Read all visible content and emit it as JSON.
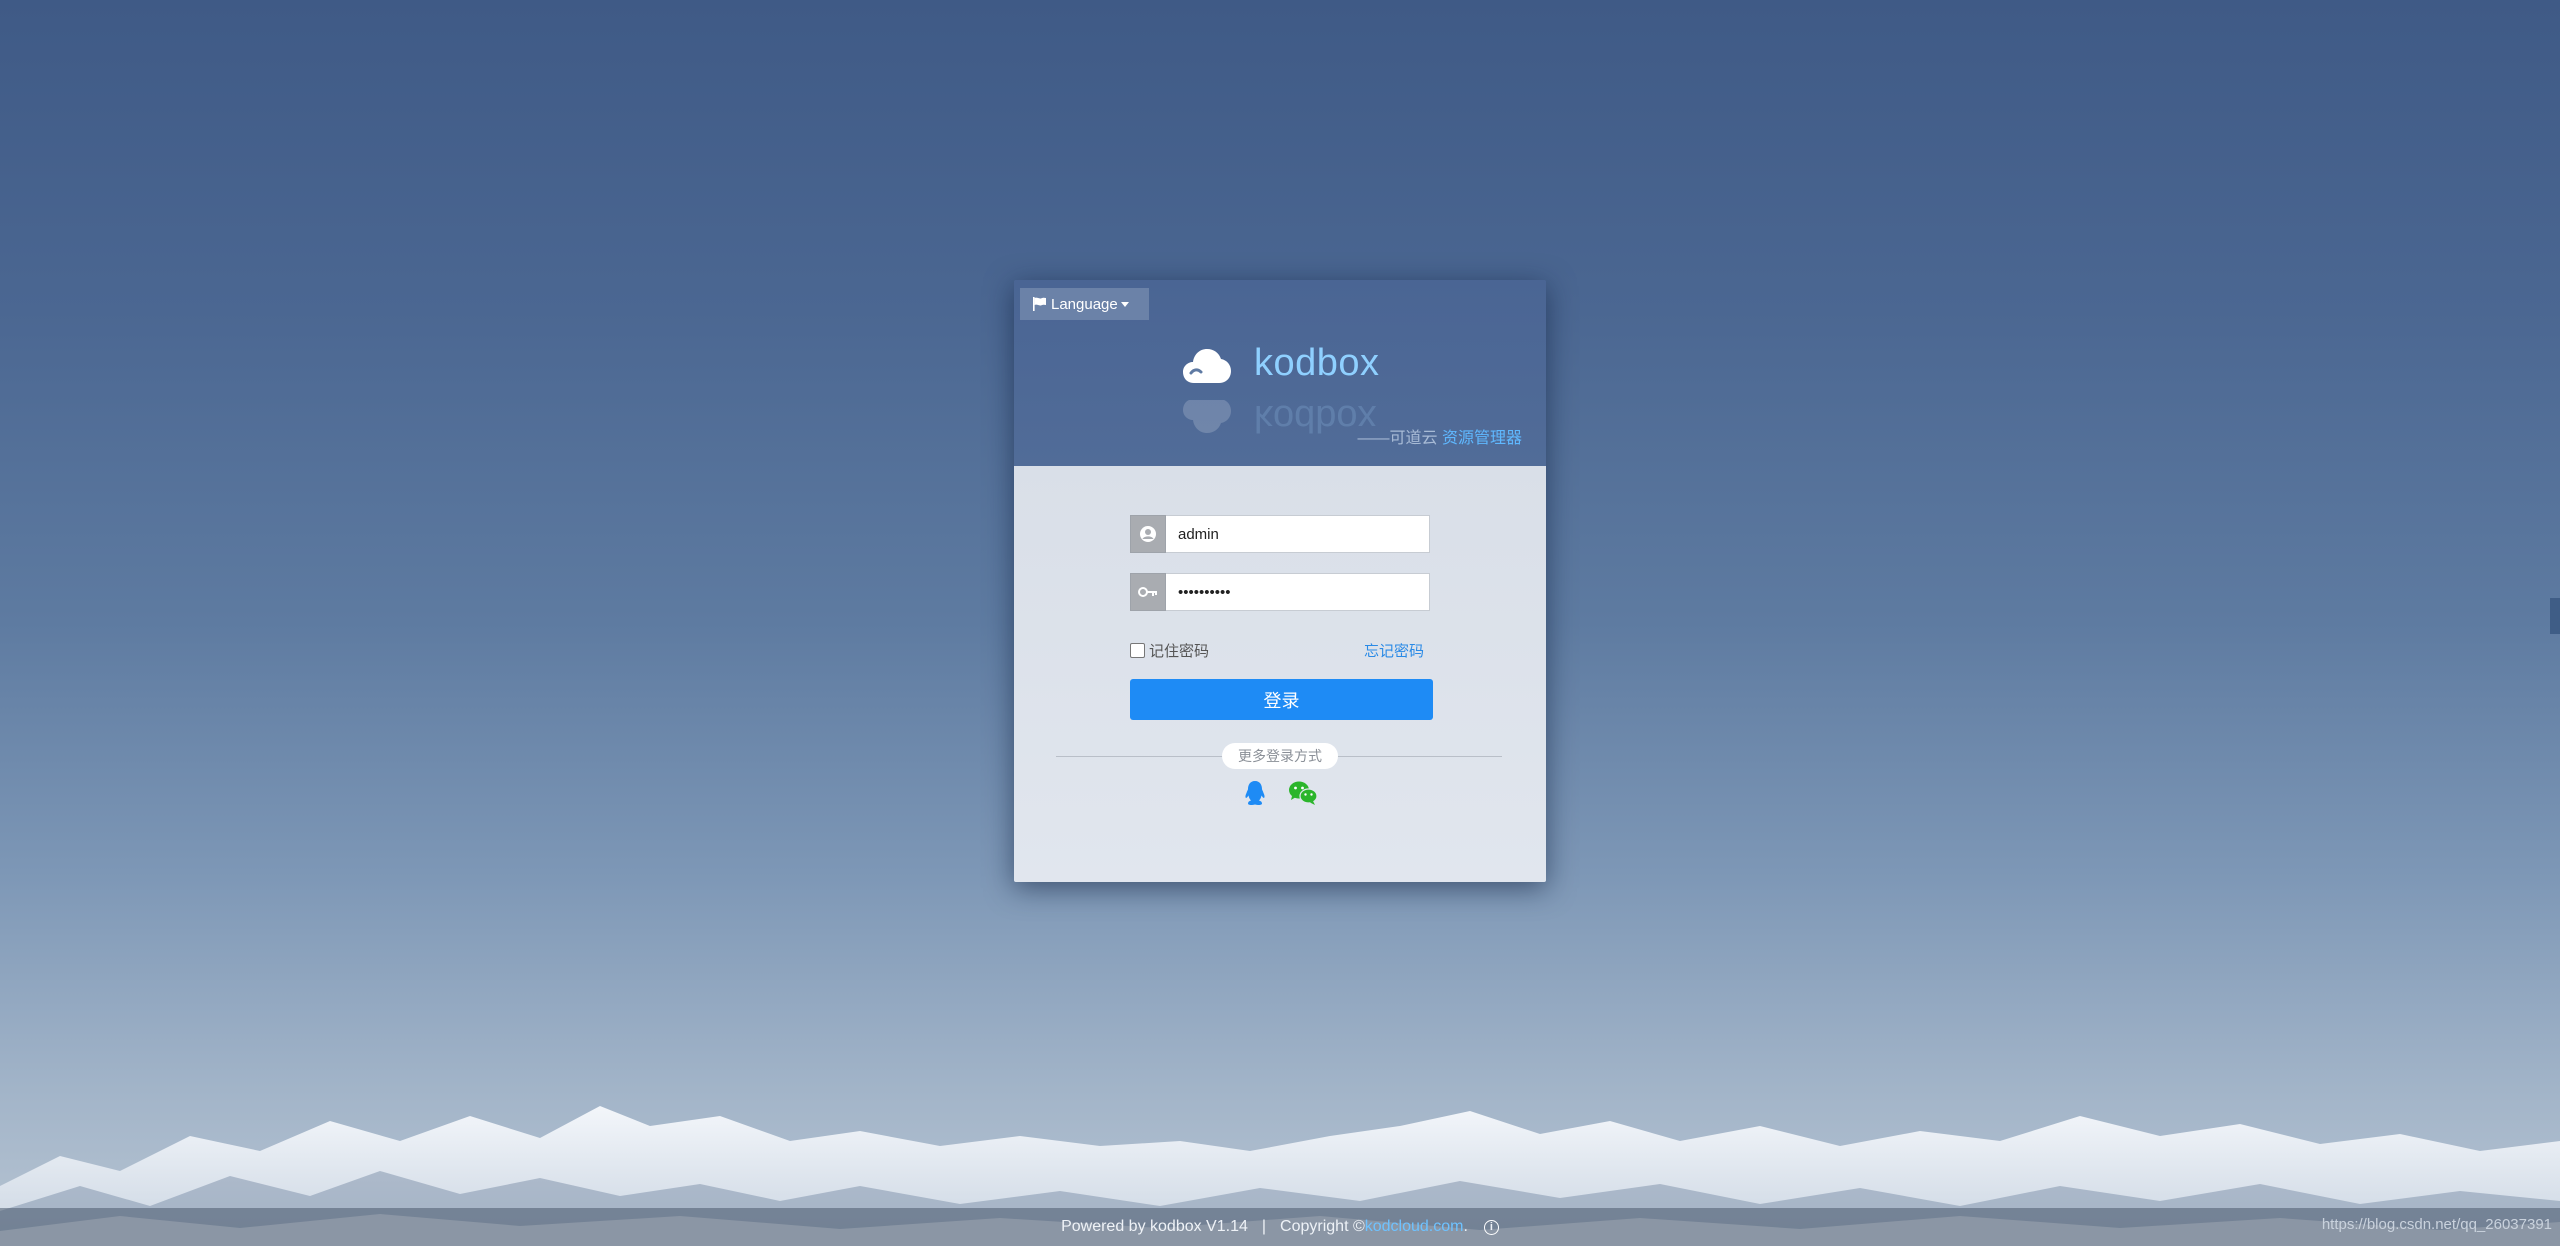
{
  "language_button": {
    "label": "Language",
    "icon": "flag-icon"
  },
  "logo": {
    "name": "kodbox",
    "icon": "cloud-icon"
  },
  "tagline": {
    "prefix": "——可道云 ",
    "accent": "资源管理器"
  },
  "form": {
    "username_value": "admin",
    "password_value": "••••••••••",
    "remember_label": "记住密码",
    "forgot_label": "忘记密码",
    "login_label": "登录",
    "more_login_label": "更多登录方式"
  },
  "social": [
    {
      "name": "qq-icon",
      "color": "#1e8bf5"
    },
    {
      "name": "wechat-icon",
      "color": "#2bb52b"
    }
  ],
  "footer": {
    "powered": "Powered by kodbox V1.14",
    "separator": "|",
    "copyright": "Copyright © ",
    "link": "kodcloud.com",
    "link_suffix": "."
  },
  "watermark": "https://blog.csdn.net/qq_26037391",
  "colors": {
    "accent": "#1e8bf5",
    "logo_text": "#8fd0ff",
    "link": "#2a8ae6"
  }
}
